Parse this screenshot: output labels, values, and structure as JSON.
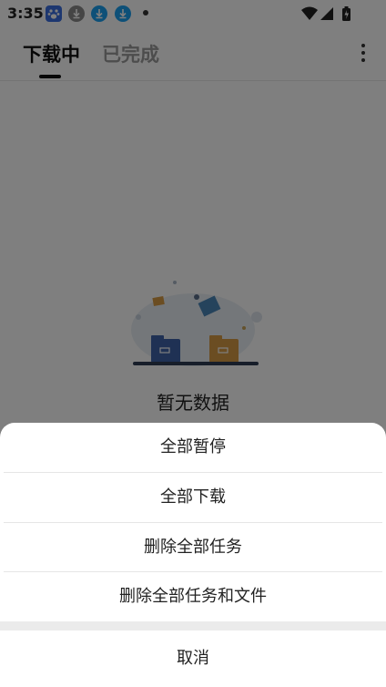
{
  "status_bar": {
    "time": "3:35",
    "icons": [
      "baidu-app-icon",
      "download-notification-icon",
      "download-notification-icon",
      "download-notification-icon",
      "more-dot-icon",
      "wifi-icon",
      "signal-icon",
      "battery-charging-icon"
    ]
  },
  "header": {
    "tabs": [
      {
        "label": "下载中",
        "active": true
      },
      {
        "label": "已完成",
        "active": false
      }
    ],
    "menu_icon": "more-vertical-icon"
  },
  "empty_state": {
    "illustration": "empty-folders-illustration",
    "text": "暂无数据"
  },
  "action_sheet": {
    "items": [
      {
        "label": "全部暂停"
      },
      {
        "label": "全部下载"
      },
      {
        "label": "删除全部任务"
      },
      {
        "label": "删除全部任务和文件"
      }
    ],
    "cancel_label": "取消"
  },
  "colors": {
    "accent": "#111111",
    "inactive_tab": "#9a9a9a",
    "scrim": "rgba(0,0,0,0.5)",
    "folder_blue": "#3f63a8",
    "folder_orange": "#d69a45"
  }
}
